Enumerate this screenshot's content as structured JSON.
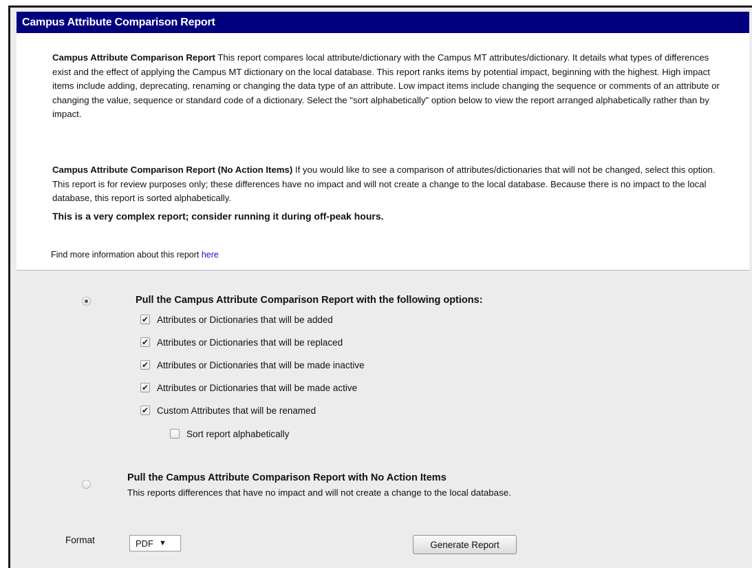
{
  "header": {
    "title": "Campus Attribute Comparison Report"
  },
  "intro": {
    "p1_bold": "Campus Attribute Comparison Report",
    "p1_text": " This report compares local attribute/dictionary with the Campus MT attributes/dictionary. It details what types of differences exist and the effect of applying the Campus MT dictionary on the local database. This report ranks items by potential impact, beginning with the highest. High impact items include adding, deprecating, renaming or changing the data type of an attribute. Low impact items include changing the sequence or comments of an attribute or changing the value, sequence or standard code of a dictionary. Select the \"sort alphabetically\" option below to view the report arranged alphabetically rather than by impact.",
    "p2_bold": "Campus Attribute Comparison Report (No Action Items)",
    "p2_text": " If you would like to see a comparison of attributes/dictionaries that will not be changed, select this option. This report is for review purposes only; these differences have no impact and will not create a change to the local database. Because there is no impact to the local database, this report is sorted alphabetically.",
    "warning": "This is a very complex report; consider running it during off-peak hours.",
    "more_prefix": "Find more information about this report ",
    "more_link": "here"
  },
  "options": {
    "option1": {
      "label": "Pull the Campus Attribute Comparison Report with the following options:",
      "selected": true,
      "checkboxes": [
        {
          "label": "Attributes or Dictionaries that will be added",
          "checked": true
        },
        {
          "label": "Attributes or Dictionaries that will be replaced",
          "checked": true
        },
        {
          "label": "Attributes or Dictionaries that will be made inactive",
          "checked": true
        },
        {
          "label": "Attributes or Dictionaries that will be made active",
          "checked": true
        },
        {
          "label": "Custom Attributes that will be renamed",
          "checked": true
        }
      ],
      "sort": {
        "label": "Sort report alphabetically",
        "checked": false
      }
    },
    "option2": {
      "label": "Pull the Campus Attribute Comparison Report with No Action Items",
      "description": "This reports differences that have no impact and will not create a change to the local database.",
      "selected": false
    }
  },
  "format": {
    "label": "Format",
    "value": "PDF"
  },
  "generate_button": "Generate Report",
  "colors": {
    "header_bg": "#00007f",
    "page_bg": "#ececec",
    "link": "#1a0dcc"
  }
}
